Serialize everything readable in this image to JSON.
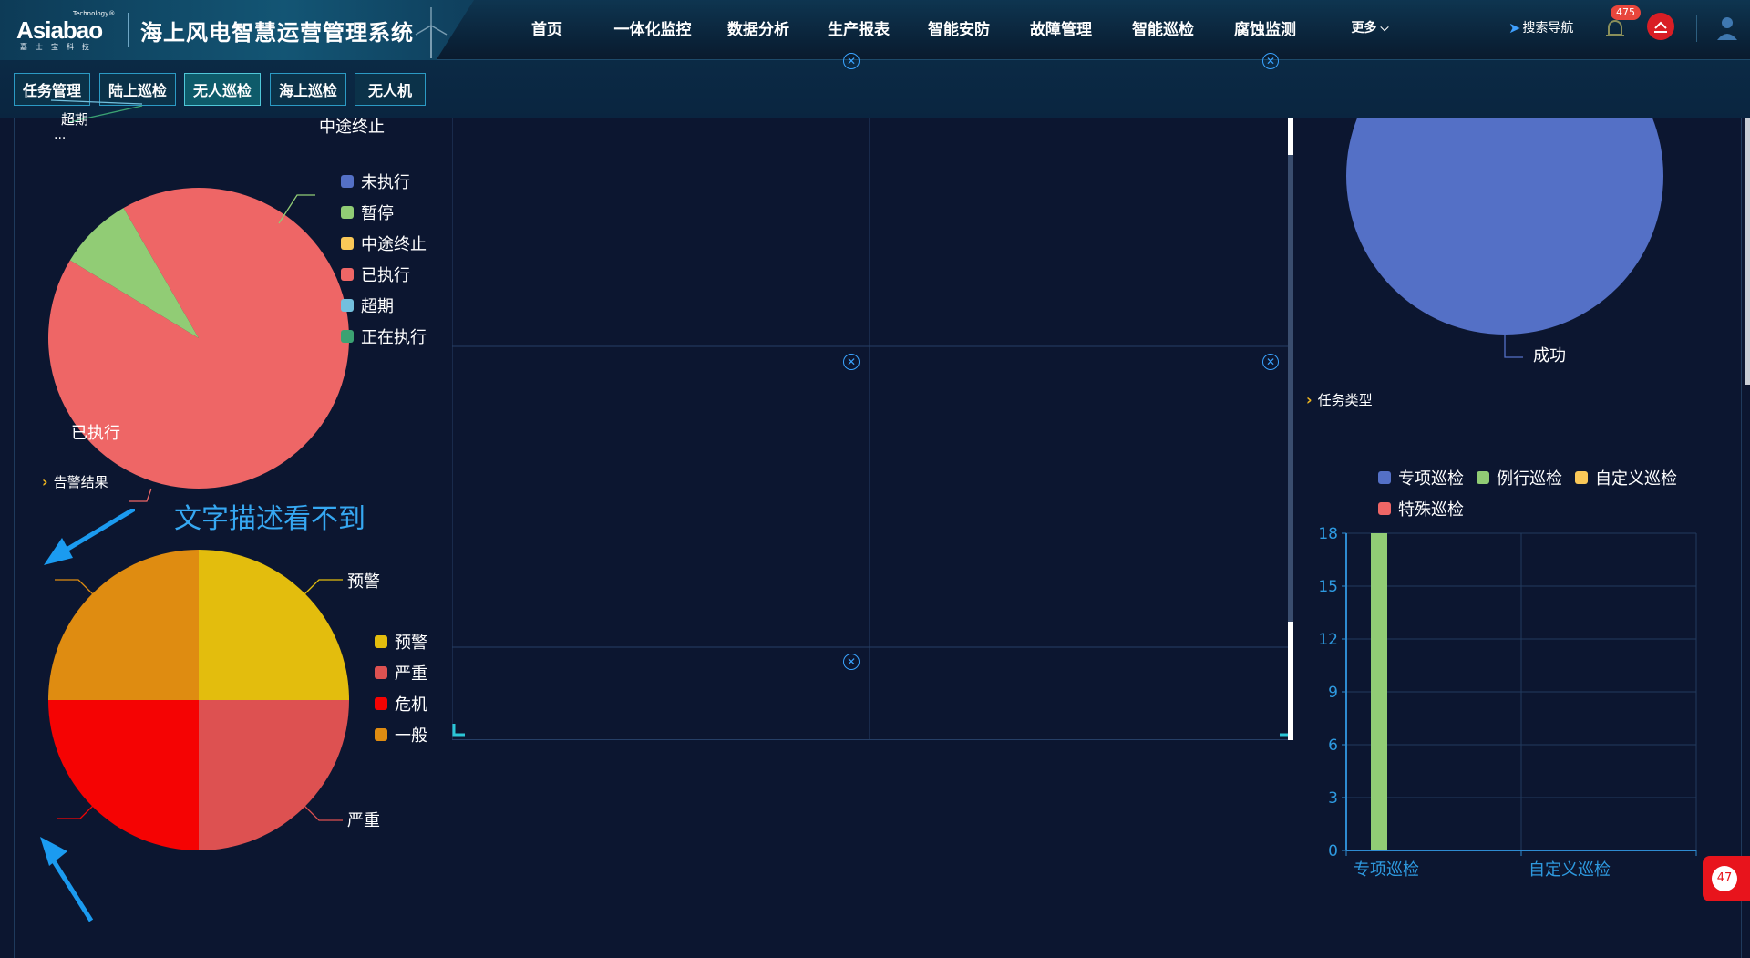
{
  "header": {
    "logo_tech": "Technology®",
    "logo_word": "Asiabao",
    "logo_sub": "嘉士宝科技",
    "system_title": "海上风电智慧运营管理系统",
    "nav": [
      {
        "label": "首页"
      },
      {
        "label": "一体化监控"
      },
      {
        "label": "数据分析"
      },
      {
        "label": "生产报表"
      },
      {
        "label": "智能安防"
      },
      {
        "label": "故障管理"
      },
      {
        "label": "智能巡检"
      },
      {
        "label": "腐蚀监测"
      }
    ],
    "nav_more": "更多",
    "active_nav": "智能巡检",
    "search_nav": "搜索导航",
    "alarm_count": "475"
  },
  "subtabs": [
    {
      "label": "任务管理"
    },
    {
      "label": "陆上巡检"
    },
    {
      "label": "无人巡检"
    },
    {
      "label": "海上巡检"
    },
    {
      "label": "无人机"
    }
  ],
  "active_subtab": "无人巡检",
  "left": {
    "task_pie": {
      "top_cut_label": "超期",
      "ellipsis": "...",
      "label_mid": "中途终止",
      "label_exec": "已执行",
      "legend": [
        {
          "name": "未执行",
          "color": "#5470c6"
        },
        {
          "name": "暂停",
          "color": "#91cc75"
        },
        {
          "name": "中途终止",
          "color": "#fac858"
        },
        {
          "name": "已执行",
          "color": "#ee6666"
        },
        {
          "name": "超期",
          "color": "#73c0de"
        },
        {
          "name": "正在执行",
          "color": "#3ba272"
        }
      ]
    },
    "alarm_title": "告警结果",
    "annotation": "文字描述看不到",
    "alarm_pie": {
      "label_warn": "预警",
      "label_serious": "严重",
      "legend": [
        {
          "name": "预警",
          "color": "#e3bd0d"
        },
        {
          "name": "严重",
          "color": "#dd5151"
        },
        {
          "name": "危机",
          "color": "#f50303"
        },
        {
          "name": "一般",
          "color": "#df8c11"
        }
      ]
    }
  },
  "right": {
    "result_pie_label": "成功",
    "task_type_title": "任务类型",
    "legend": [
      {
        "name": "专项巡检",
        "color": "#5470c6"
      },
      {
        "name": "例行巡检",
        "color": "#91cc75"
      },
      {
        "name": "自定义巡检",
        "color": "#fac858"
      },
      {
        "name": "特殊巡检",
        "color": "#ee6666"
      }
    ]
  },
  "float_count": "47",
  "chart_data": [
    {
      "type": "pie",
      "slices": [
        {
          "name": "已执行",
          "value": 92,
          "color": "#ee6666"
        },
        {
          "name": "暂停",
          "value": 8,
          "color": "#91cc75"
        }
      ]
    },
    {
      "type": "pie",
      "slices": [
        {
          "name": "预警",
          "value": 25,
          "color": "#e3bd0d"
        },
        {
          "name": "严重",
          "value": 25,
          "color": "#dd5151"
        },
        {
          "name": "危机",
          "value": 25,
          "color": "#f50303"
        },
        {
          "name": "一般",
          "value": 25,
          "color": "#df8c11"
        }
      ]
    },
    {
      "type": "pie",
      "slices": [
        {
          "name": "成功",
          "value": 100,
          "color": "#5470c6"
        }
      ]
    },
    {
      "type": "bar",
      "categories": [
        "专项巡检",
        "自定义巡检"
      ],
      "series": [
        {
          "name": "例行巡检",
          "values": [
            18,
            0
          ],
          "color": "#91cc75"
        }
      ],
      "yticks": [
        0,
        3,
        6,
        9,
        12,
        15,
        18
      ],
      "ylim": [
        0,
        18
      ],
      "grid": true
    }
  ]
}
